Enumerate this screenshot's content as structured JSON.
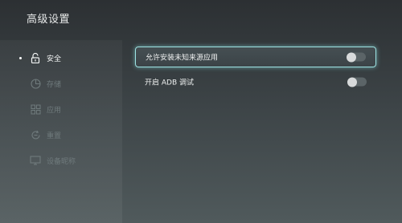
{
  "header": {
    "title": "高级设置"
  },
  "sidebar": {
    "items": [
      {
        "label": "安全",
        "icon": "lock-open-icon",
        "active": true
      },
      {
        "label": "存储",
        "icon": "storage-icon",
        "active": false
      },
      {
        "label": "应用",
        "icon": "apps-icon",
        "active": false
      },
      {
        "label": "重置",
        "icon": "reset-icon",
        "active": false
      },
      {
        "label": "设备昵称",
        "icon": "device-icon",
        "active": false
      }
    ]
  },
  "settings": {
    "rows": [
      {
        "label": "允许安装未知来源应用",
        "toggle": "off",
        "focused": true
      },
      {
        "label": "开启 ADB 调试",
        "toggle": "off",
        "focused": false
      }
    ]
  },
  "colors": {
    "focus_border": "#9de3e3",
    "active_text": "#f2f4f4",
    "dim_text": "#6f7a7c"
  }
}
